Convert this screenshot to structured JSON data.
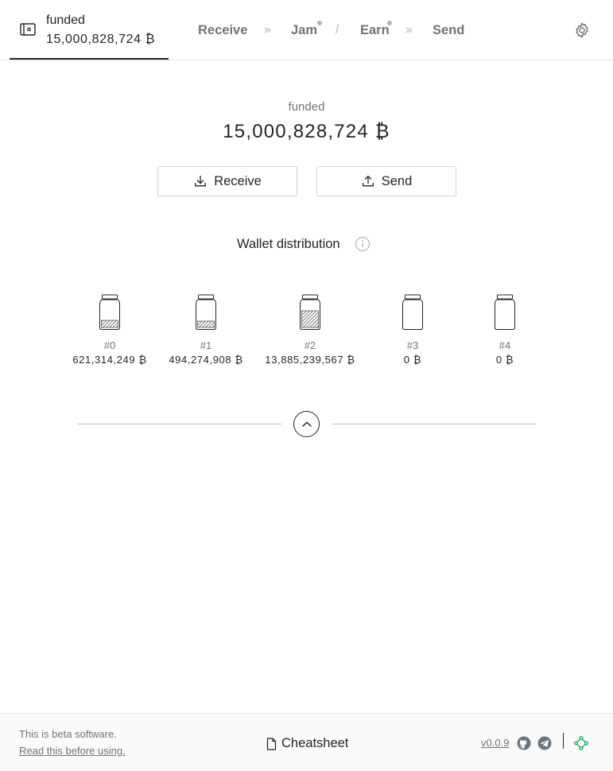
{
  "header": {
    "wallet_name": "funded",
    "wallet_balance": "15,000,828,724",
    "btc_symbol": "₿",
    "nav": {
      "receive": "Receive",
      "sep1": "»",
      "jam": "Jam",
      "sep2": "/",
      "earn": "Earn",
      "sep3": "»",
      "send": "Send"
    },
    "settings_icon": "gear-icon"
  },
  "main": {
    "wallet_name": "funded",
    "balance": "15,000,828,724",
    "btc_symbol": "₿",
    "receive_label": "Receive",
    "send_label": "Send",
    "distribution_label": "Wallet distribution",
    "jars": [
      {
        "index": "#0",
        "balance": "621,314,249",
        "fill": 0.3
      },
      {
        "index": "#1",
        "balance": "494,274,908",
        "fill": 0.25
      },
      {
        "index": "#2",
        "balance": "13,885,239,567",
        "fill": 0.7
      },
      {
        "index": "#3",
        "balance": "0",
        "fill": 0
      },
      {
        "index": "#4",
        "balance": "0",
        "fill": 0
      }
    ]
  },
  "footer": {
    "beta_text": "This is beta software.",
    "readme_link": "Read this before using.",
    "cheatsheet": "Cheatsheet",
    "version": "v0.0.9"
  },
  "colors": {
    "text": "#212529",
    "muted": "#6c757d",
    "accent_green": "#27ae60"
  }
}
